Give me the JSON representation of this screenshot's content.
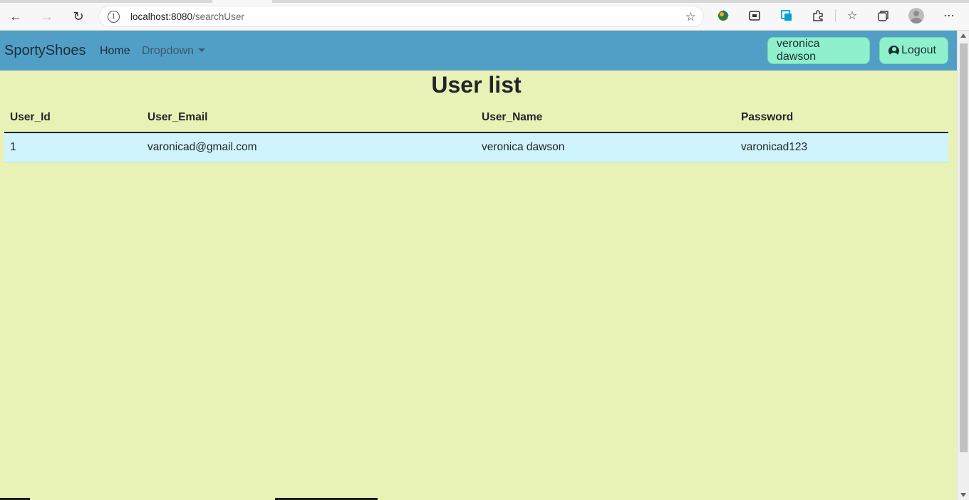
{
  "browser": {
    "url_host": "localhost:8080",
    "url_path": "/searchUser"
  },
  "navbar": {
    "brand": "SportyShoes",
    "links": [
      {
        "label": "Home"
      },
      {
        "label": "Dropdown"
      }
    ],
    "user_button": "veronica dawson",
    "logout_button": "Logout"
  },
  "page": {
    "title": "User list"
  },
  "table": {
    "headers": [
      "User_Id",
      "User_Email",
      "User_Name",
      "Password"
    ],
    "rows": [
      [
        "1",
        "varonicad@gmail.com",
        "veronica dawson",
        "varonicad123"
      ]
    ]
  },
  "colors": {
    "navbar_bg": "#519fc6",
    "page_bg": "#e9f2b6",
    "button_bg": "#8ff0cc",
    "row_bg": "#cff4fc"
  }
}
